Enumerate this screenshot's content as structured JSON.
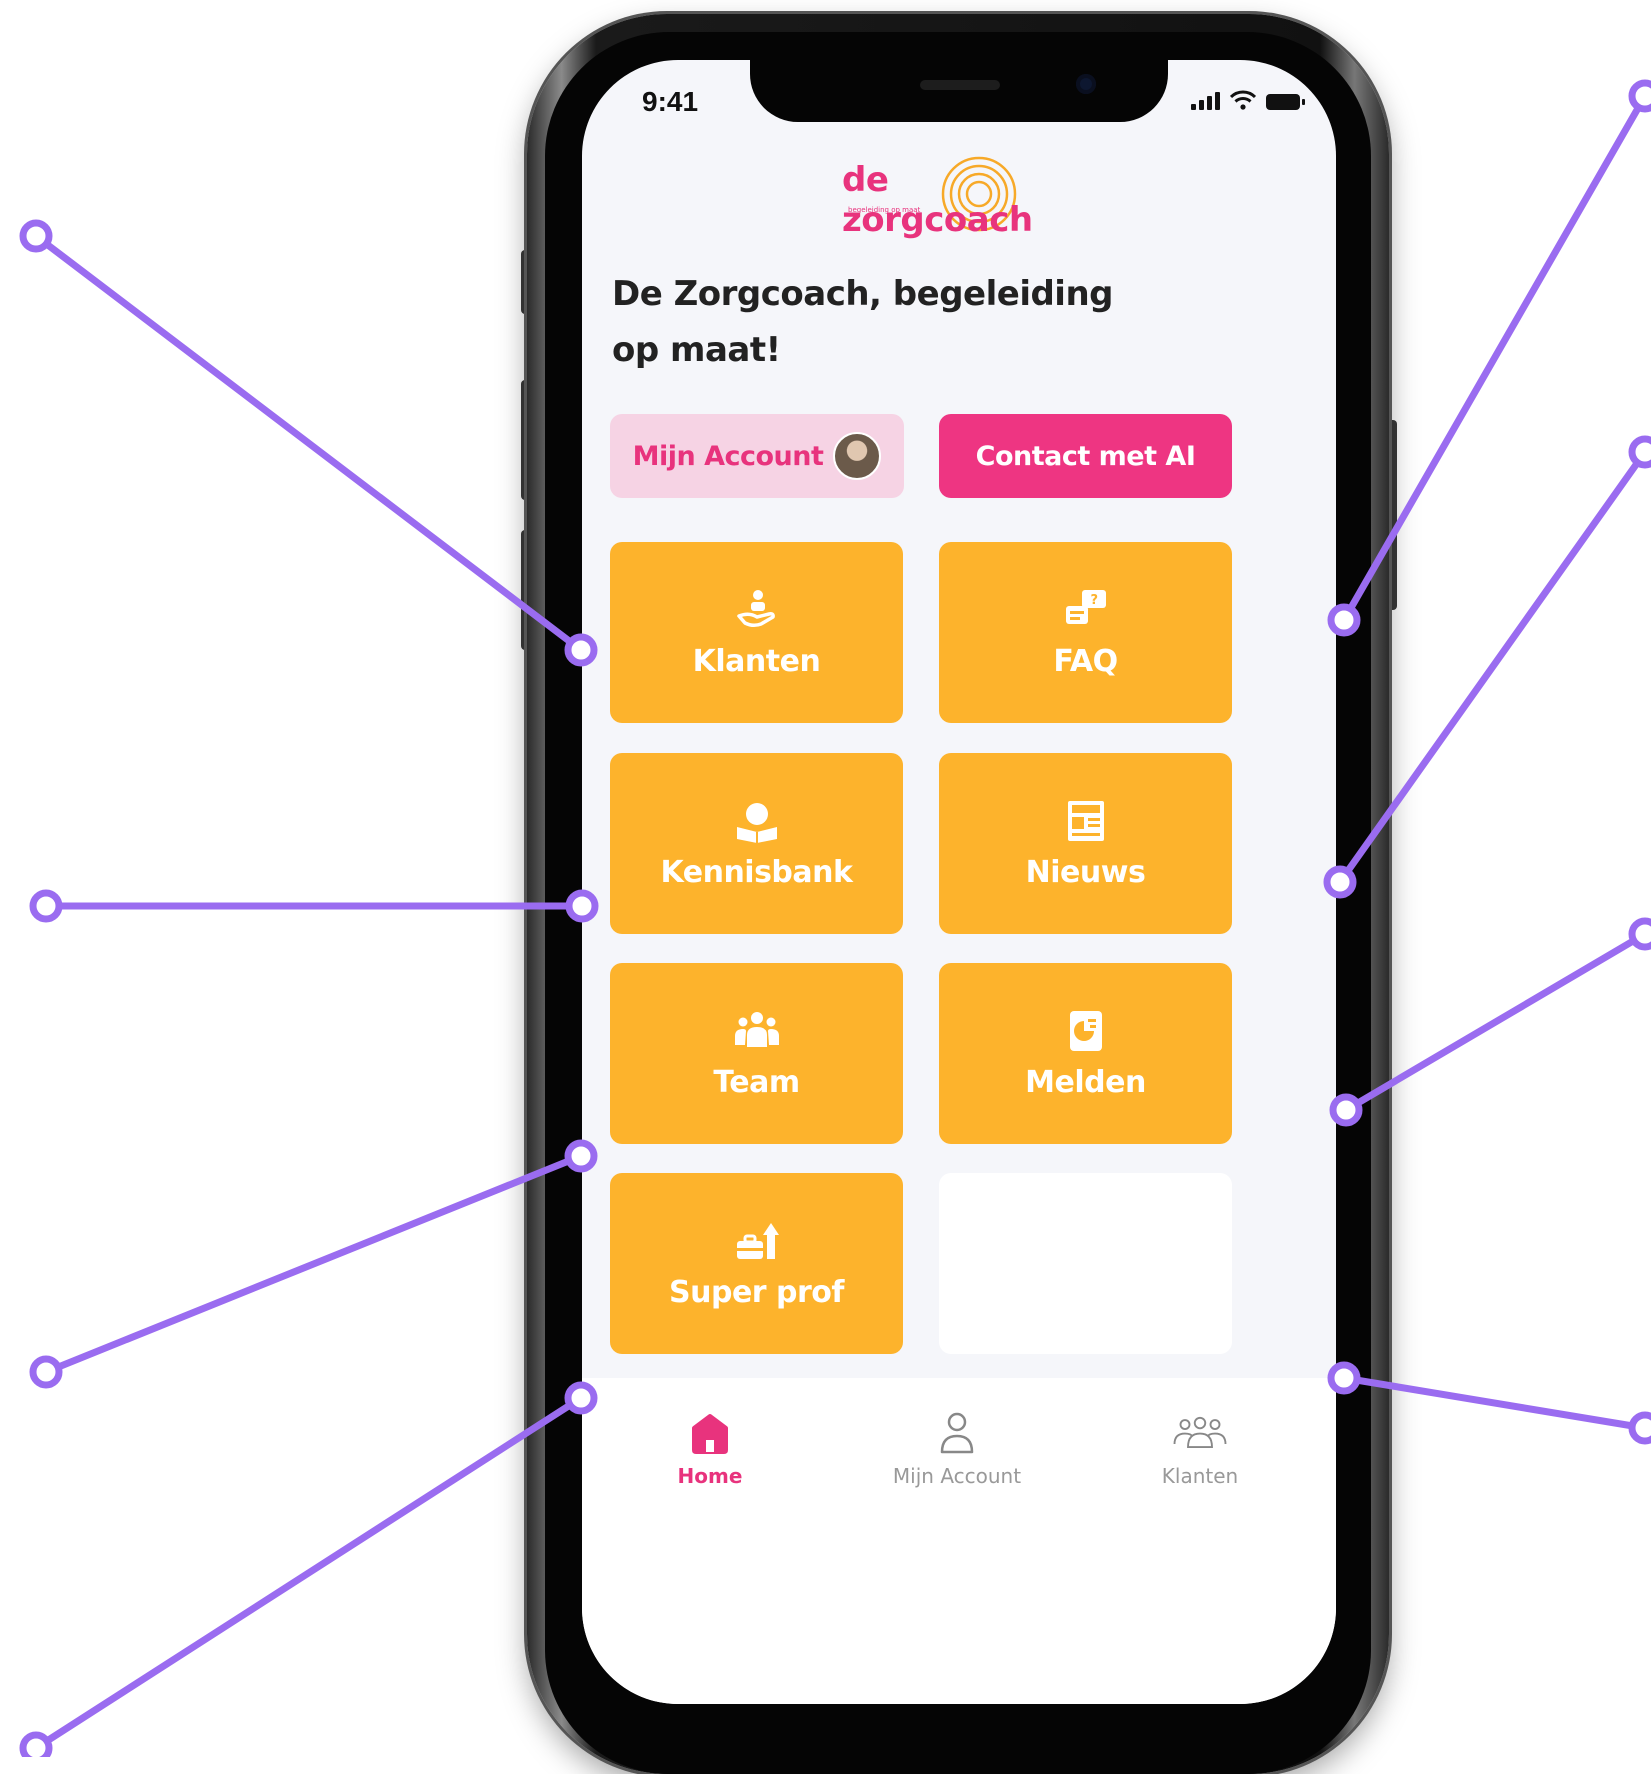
{
  "status_bar": {
    "time": "9:41"
  },
  "brand": {
    "logo_text": "de zorgcoach",
    "logo_subtitle": "begeleiding op maat"
  },
  "headline": {
    "line1": "De Zorgcoach, begeleiding",
    "line2": "op maat!"
  },
  "actions": {
    "account_label": "Mijn Account",
    "contact_label": "Contact met AI"
  },
  "tiles": [
    {
      "label": "Klanten",
      "icon": "care-hand-icon"
    },
    {
      "label": "FAQ",
      "icon": "faq-chat-icon"
    },
    {
      "label": "Kennisbank",
      "icon": "knowledge-book-icon"
    },
    {
      "label": "Nieuws",
      "icon": "newspaper-icon"
    },
    {
      "label": "Team",
      "icon": "team-icon"
    },
    {
      "label": "Melden",
      "icon": "report-icon"
    },
    {
      "label": "Super prof",
      "icon": "briefcase-up-icon"
    }
  ],
  "tabbar": {
    "items": [
      {
        "label": "Home",
        "icon": "home-icon",
        "active": true
      },
      {
        "label": "Mijn Account",
        "icon": "user-icon",
        "active": false
      },
      {
        "label": "Klanten",
        "icon": "users-icon",
        "active": false
      }
    ]
  },
  "colors": {
    "brand_pink": "#e8337d",
    "tile_yellow": "#fdb32c",
    "callout_purple": "#9a6cf0"
  }
}
